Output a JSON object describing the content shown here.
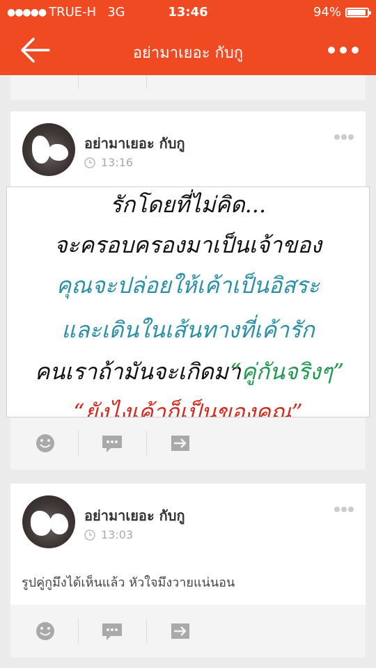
{
  "status_bar": {
    "signal_dots": "●●●●●",
    "carrier": "TRUE-H",
    "network": "3G",
    "time": "13:46",
    "battery": "94%",
    "battery_level": 0.94
  },
  "header": {
    "title": "อย่ามาเยอะ กับกู"
  },
  "posts": [
    {
      "author": "อย่ามาเยอะ กับกู",
      "time": "13:16",
      "image_lines": [
        "รักโดยที่ไม่คิด...",
        "จะครอบครองมาเป็นเจ้าของ",
        "คุณจะปล่อยให้เค้าเป็นอิสระ",
        "และเดินในเส้นทางที่เค้ารัก",
        "คนเราถ้ามันจะเกิดมา",
        "“คู่กันจริงๆ”",
        "“ยังไงเค้าก็เป็นของคุณ”"
      ]
    },
    {
      "author": "อย่ามาเยอะ กับกู",
      "time": "13:03",
      "text": "รูปคู่กูมึงได้เห็นแล้ว หัวใจมึงวายแน่นอน"
    }
  ],
  "colors": {
    "brand": "#f04a23",
    "text_black": "#111111",
    "text_blue": "#2c8fa8",
    "text_green": "#1f9a4e",
    "text_red": "#d42a1e"
  },
  "icons": [
    "back-arrow-icon",
    "more-dots-icon",
    "smiley-icon",
    "comment-icon",
    "share-icon",
    "clock-icon"
  ]
}
